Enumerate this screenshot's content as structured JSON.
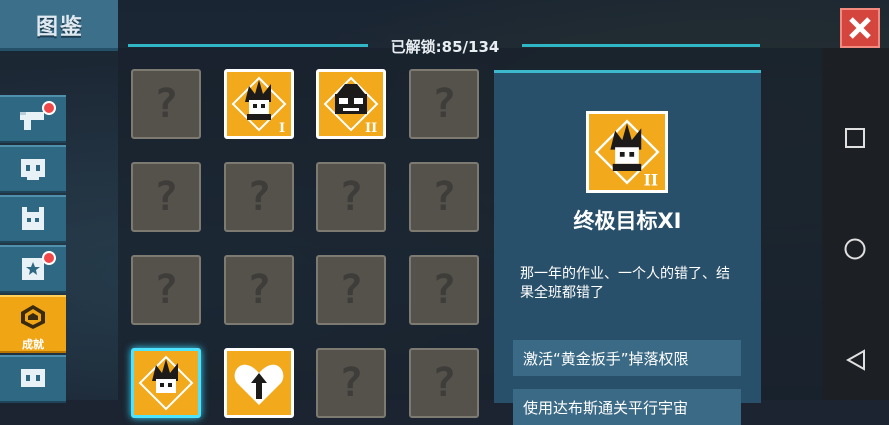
{
  "header": {
    "title": "图鉴",
    "unlocked": "已解锁:85/134"
  },
  "sidebar": {
    "items": [
      {
        "name": "weapons",
        "icon": "gun-icon",
        "badge": true,
        "label": ""
      },
      {
        "name": "skins",
        "icon": "character-face-icon",
        "badge": false,
        "label": ""
      },
      {
        "name": "pets",
        "icon": "pet-icon",
        "badge": false,
        "label": ""
      },
      {
        "name": "buffs",
        "icon": "star-card-icon",
        "badge": true,
        "label": ""
      },
      {
        "name": "achievements",
        "icon": "achievement-badge-icon",
        "badge": false,
        "label": "成就"
      },
      {
        "name": "more",
        "icon": "character-face-icon",
        "badge": false,
        "label": ""
      }
    ],
    "active": "achievements"
  },
  "grid": {
    "cells": [
      {
        "state": "locked",
        "symbol": "?"
      },
      {
        "state": "unlocked",
        "icon": "spiky-hero-icon",
        "tier": "I"
      },
      {
        "state": "unlocked",
        "icon": "goggles-hero-icon",
        "tier": "II"
      },
      {
        "state": "locked",
        "symbol": "?"
      },
      {
        "state": "locked",
        "symbol": "?"
      },
      {
        "state": "locked",
        "symbol": "?"
      },
      {
        "state": "locked",
        "symbol": "?"
      },
      {
        "state": "locked",
        "symbol": "?"
      },
      {
        "state": "locked",
        "symbol": "?"
      },
      {
        "state": "locked",
        "symbol": "?"
      },
      {
        "state": "locked",
        "symbol": "?"
      },
      {
        "state": "locked",
        "symbol": "?"
      },
      {
        "state": "unlocked",
        "icon": "spiky-hero-icon",
        "tier": "",
        "selected": true
      },
      {
        "state": "unlocked",
        "icon": "heart-arrow-icon",
        "tier": ""
      },
      {
        "state": "locked",
        "symbol": "?"
      },
      {
        "state": "locked",
        "symbol": "?"
      }
    ]
  },
  "detail": {
    "icon": "spiky-hero-icon",
    "tier": "II",
    "name": "终极目标XI",
    "description": "那一年的作业、一个人的错了、结果全班都错了",
    "rewards": [
      "激活“黄金扳手”掉落权限",
      "使用达布斯通关平行宇宙"
    ]
  },
  "colors": {
    "accent": "#2fb7c6",
    "gold": "#f2a91b",
    "close": "#d4463d",
    "panel": "#29506a"
  },
  "navbar": {
    "buttons": [
      "recent-apps-icon",
      "home-icon",
      "back-icon"
    ]
  }
}
